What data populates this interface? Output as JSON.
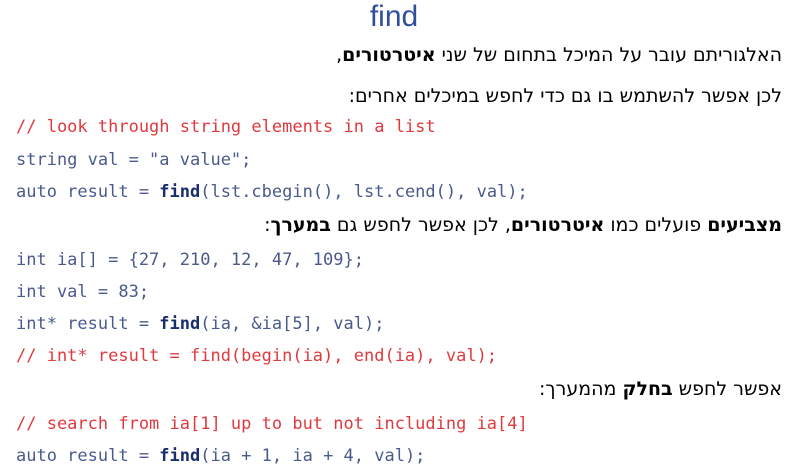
{
  "title": "find",
  "lines": [
    {
      "type": "heb",
      "parts": [
        {
          "t": "האלגוריתם עובר על המיכל בתחום של שני "
        },
        {
          "t": "איטרטורים",
          "b": true
        },
        {
          "t": ","
        }
      ]
    },
    {
      "type": "heb",
      "parts": [
        {
          "t": "לכן אפשר להשתמש בו גם כדי לחפש במיכלים אחרים:"
        }
      ]
    },
    {
      "type": "comment",
      "parts": [
        {
          "t": "// look through string elements in a list"
        }
      ]
    },
    {
      "type": "code",
      "parts": [
        {
          "t": "string val = \"a value\";"
        }
      ]
    },
    {
      "type": "code",
      "parts": [
        {
          "t": "auto result = "
        },
        {
          "t": "find",
          "b": true
        },
        {
          "t": "(lst.cbegin(), lst.cend(), val);"
        }
      ]
    },
    {
      "type": "heb",
      "parts": [
        {
          "t": "מצביעים",
          "b": true
        },
        {
          "t": " פועלים כמו "
        },
        {
          "t": "איטרטורים",
          "b": true
        },
        {
          "t": ", לכן אפשר לחפש גם "
        },
        {
          "t": "במערך",
          "b": true
        },
        {
          "t": ":"
        }
      ]
    },
    {
      "type": "code",
      "parts": [
        {
          "t": "int ia[] = {27, 210, 12, 47, 109};"
        }
      ]
    },
    {
      "type": "code",
      "parts": [
        {
          "t": "int val = 83;"
        }
      ]
    },
    {
      "type": "code",
      "parts": [
        {
          "t": "int* result = "
        },
        {
          "t": "find",
          "b": true
        },
        {
          "t": "(ia, &ia[5], val);"
        }
      ]
    },
    {
      "type": "comment",
      "parts": [
        {
          "t": "// int* result = find(begin(ia), end(ia), val);"
        }
      ]
    },
    {
      "type": "heb",
      "parts": [
        {
          "t": "אפשר לחפש "
        },
        {
          "t": "בחלק",
          "b": true
        },
        {
          "t": " מהמערך:"
        }
      ]
    },
    {
      "type": "comment",
      "parts": [
        {
          "t": "// search from ia[1] up to but not including ia[4]"
        }
      ]
    },
    {
      "type": "code",
      "parts": [
        {
          "t": "auto result = "
        },
        {
          "t": "find",
          "b": true
        },
        {
          "t": "(ia + 1, ia + 4, val);"
        }
      ]
    }
  ]
}
